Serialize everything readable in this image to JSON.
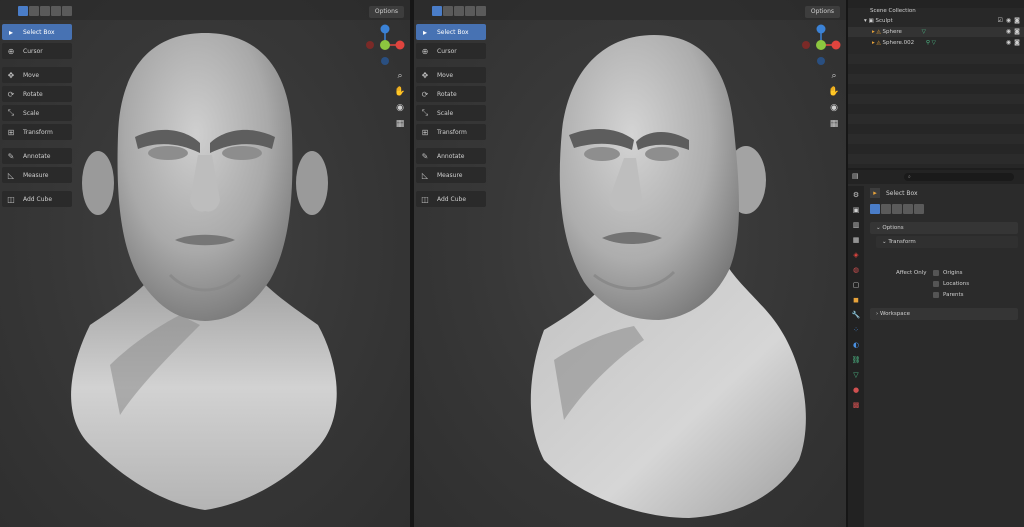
{
  "viewport": {
    "options_label": "Options",
    "tools": [
      {
        "label": "Select Box",
        "icon": "select-box-icon",
        "glyph": "▸",
        "active": true
      },
      {
        "label": "Cursor",
        "icon": "cursor-icon",
        "glyph": "⊕",
        "active": false
      },
      {
        "label": "Move",
        "icon": "move-icon",
        "glyph": "✥",
        "active": false
      },
      {
        "label": "Rotate",
        "icon": "rotate-icon",
        "glyph": "⟳",
        "active": false
      },
      {
        "label": "Scale",
        "icon": "scale-icon",
        "glyph": "⤡",
        "active": false
      },
      {
        "label": "Transform",
        "icon": "transform-icon",
        "glyph": "⊞",
        "active": false
      },
      {
        "label": "Annotate",
        "icon": "annotate-icon",
        "glyph": "✎",
        "active": false
      },
      {
        "label": "Measure",
        "icon": "measure-icon",
        "glyph": "◺",
        "active": false
      },
      {
        "label": "Add Cube",
        "icon": "add-cube-icon",
        "glyph": "◫",
        "active": false
      }
    ]
  },
  "outliner": {
    "collection_label": "Scene Collection",
    "items": [
      {
        "label": "Sculpt",
        "icon": "collection-icon"
      },
      {
        "label": "Sphere",
        "icon": "mesh-icon"
      },
      {
        "label": "Sphere.002",
        "icon": "mesh-icon"
      }
    ]
  },
  "properties": {
    "search_placeholder": "",
    "active_tool": "Select Box",
    "options_label": "Options",
    "transform_label": "Transform",
    "affect_only_label": "Affect Only",
    "checks": [
      "Origins",
      "Locations",
      "Parents"
    ],
    "workspace_label": "Workspace"
  },
  "colors": {
    "accent": "#4772b3",
    "axis_x": "#e0443e",
    "axis_y": "#8cc63f",
    "axis_z": "#3b82d6"
  }
}
